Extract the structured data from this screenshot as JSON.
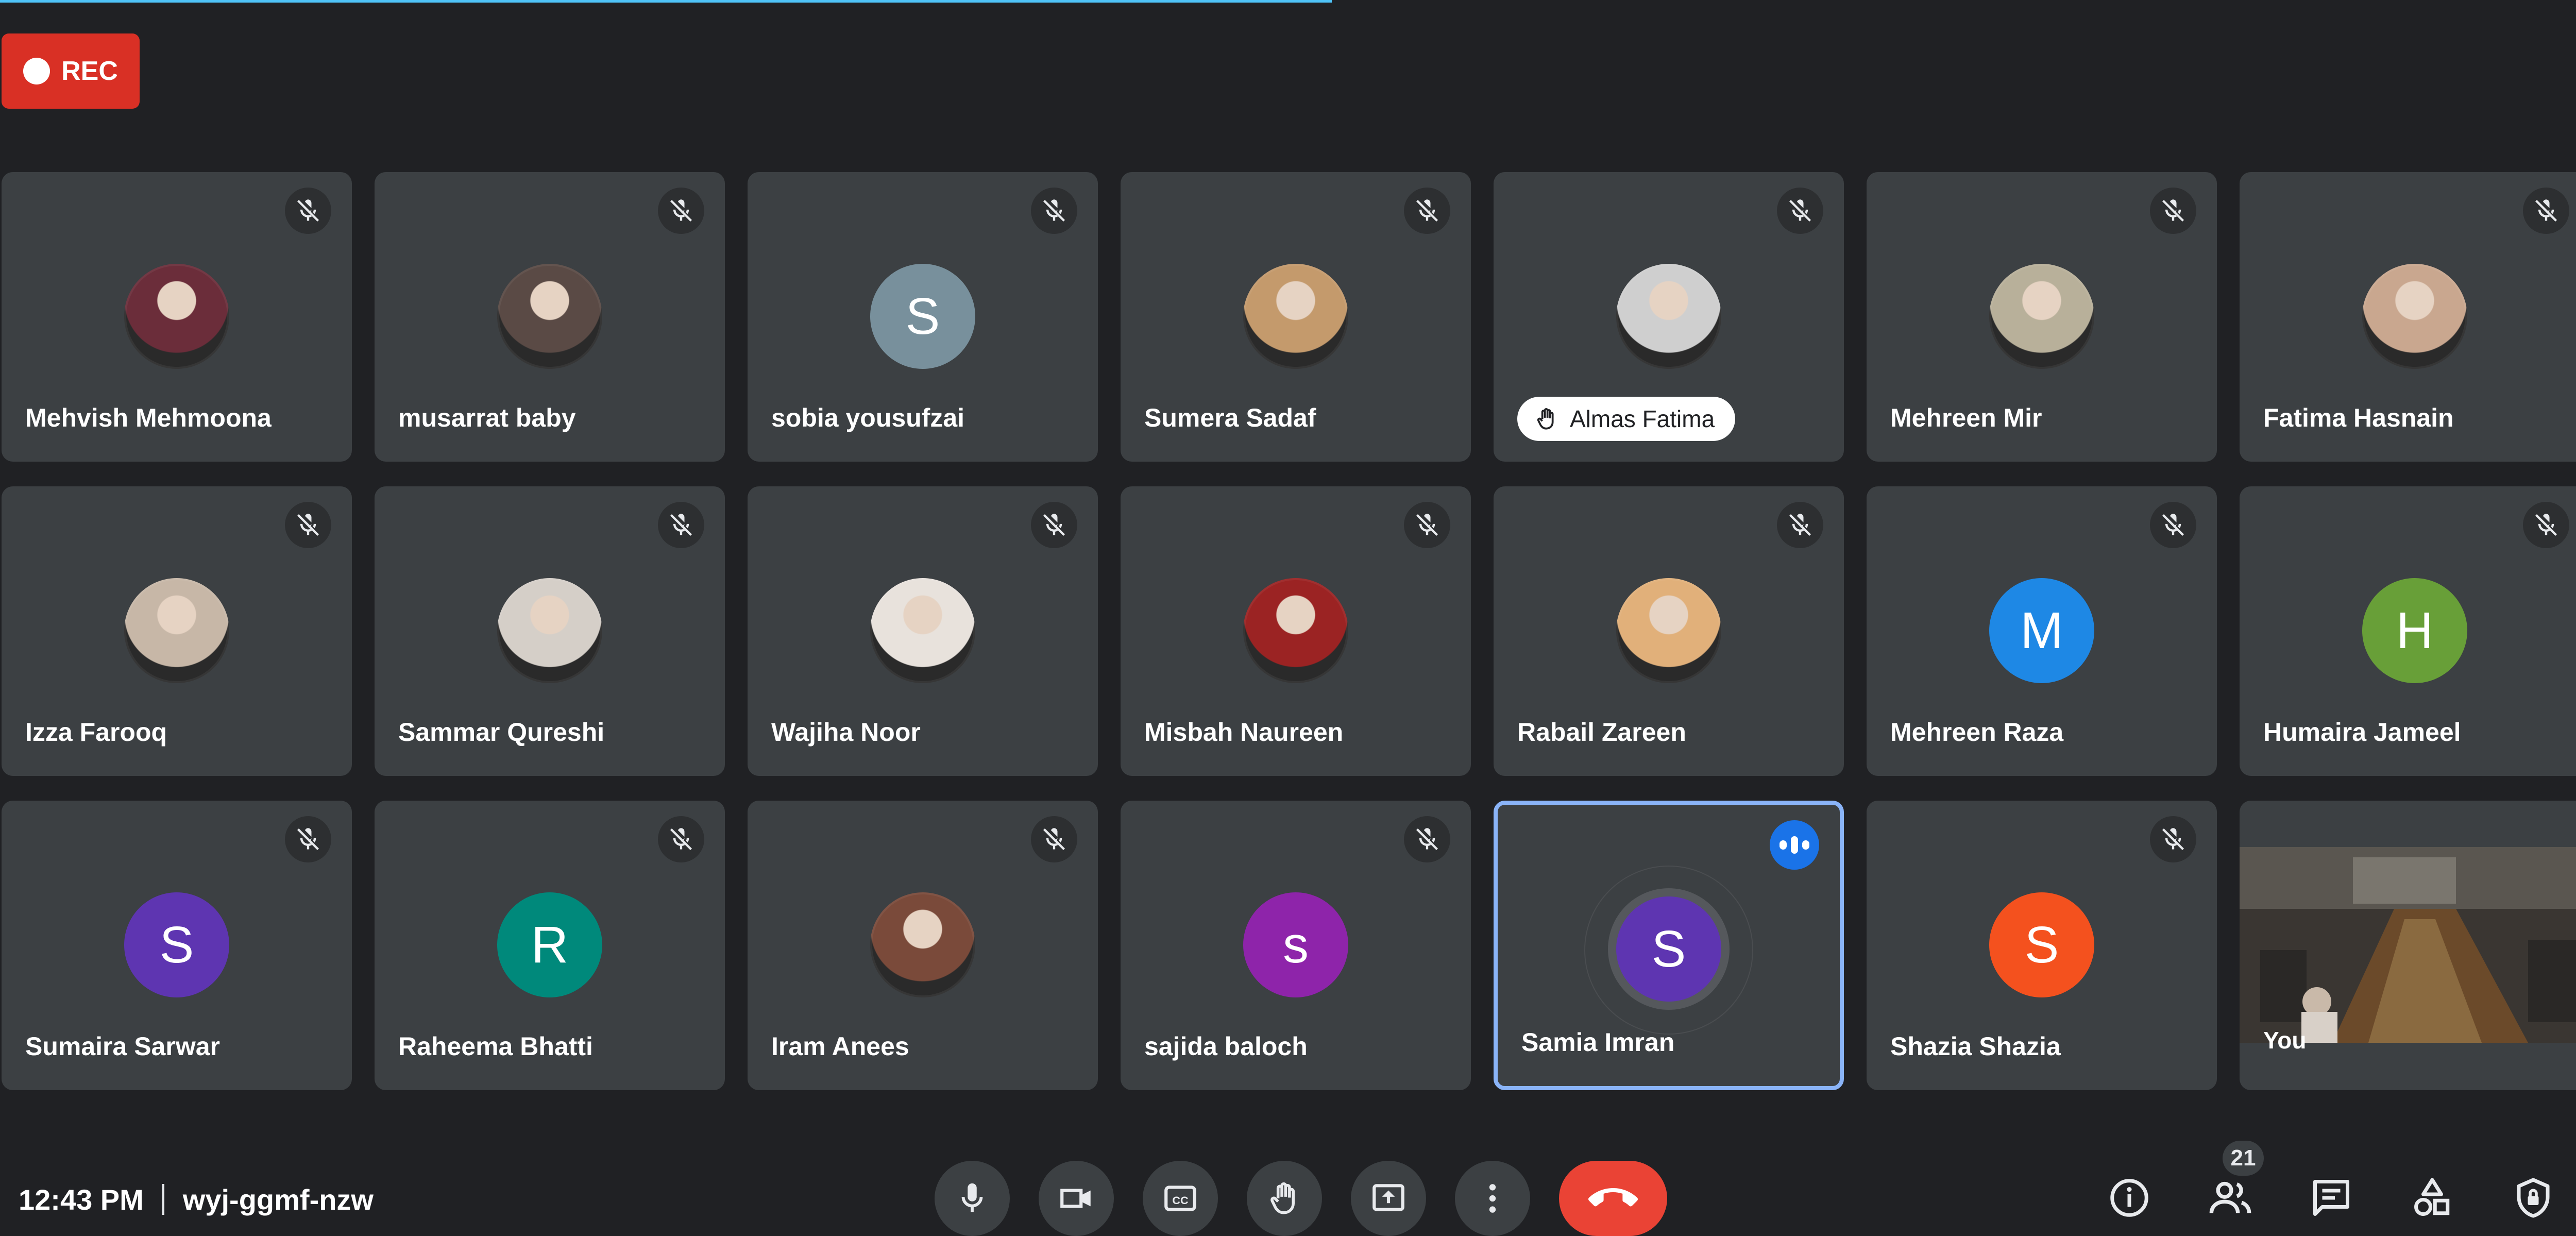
{
  "recording": {
    "label": "REC"
  },
  "participants": [
    {
      "name": "Mehvish Mehmoona",
      "type": "photo",
      "color": "#6b2d3a"
    },
    {
      "name": "musarrat baby",
      "type": "photo",
      "color": "#5a4a45"
    },
    {
      "name": "sobia yousufzai",
      "type": "letter",
      "initial": "S",
      "color": "#78909c"
    },
    {
      "name": "Sumera Sadaf",
      "type": "photo",
      "color": "#c49a6c"
    },
    {
      "name": "Almas Fatima",
      "type": "photo",
      "color": "#cfcfcf",
      "hand_raised": true
    },
    {
      "name": "Mehreen Mir",
      "type": "photo",
      "color": "#b8b09a"
    },
    {
      "name": "Fatima Hasnain",
      "type": "photo",
      "color": "#c9a78f"
    },
    {
      "name": "Izza Farooq",
      "type": "photo",
      "color": "#c7b7a7"
    },
    {
      "name": "Sammar Qureshi",
      "type": "photo",
      "color": "#d5cfc8"
    },
    {
      "name": "Wajiha Noor",
      "type": "photo",
      "color": "#e8e2dc"
    },
    {
      "name": "Misbah Naureen",
      "type": "photo",
      "color": "#9b2323"
    },
    {
      "name": "Rabail Zareen",
      "type": "photo",
      "color": "#e1b07a"
    },
    {
      "name": "Mehreen Raza",
      "type": "letter",
      "initial": "M",
      "color": "#1e88e5"
    },
    {
      "name": "Humaira Jameel",
      "type": "letter",
      "initial": "H",
      "color": "#689f38"
    },
    {
      "name": "Sumaira Sarwar",
      "type": "letter",
      "initial": "S",
      "color": "#5e35b1"
    },
    {
      "name": "Raheema Bhatti",
      "type": "letter",
      "initial": "R",
      "color": "#00897b"
    },
    {
      "name": "Iram Anees",
      "type": "photo",
      "color": "#7a4a3a"
    },
    {
      "name": "sajida baloch",
      "type": "letter",
      "initial": "s",
      "color": "#8e24aa"
    },
    {
      "name": "Samia Imran",
      "type": "letter",
      "initial": "S",
      "color": "#5e35b1",
      "speaking": true
    },
    {
      "name": "Shazia Shazia",
      "type": "letter",
      "initial": "S",
      "color": "#f4511e"
    },
    {
      "name": "You",
      "type": "self"
    }
  ],
  "footer": {
    "time": "12:43 PM",
    "meeting_code": "wyj-ggmf-nzw",
    "participant_count": "21"
  }
}
